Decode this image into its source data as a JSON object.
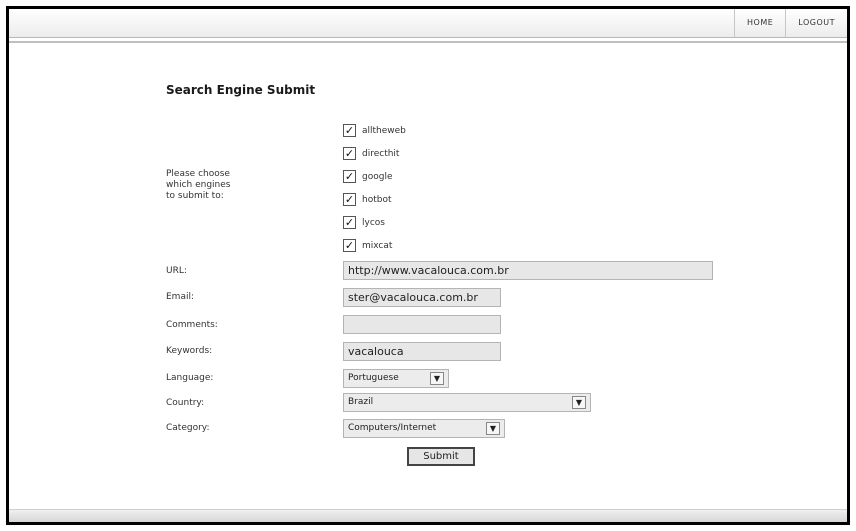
{
  "nav": {
    "home": "HOME",
    "logout": "LOGOUT"
  },
  "title": "Search Engine Submit",
  "engines": {
    "label_line1": "Please choose",
    "label_line2": "which engines",
    "label_line3": "to submit to:",
    "items": [
      {
        "name": "alltheweb",
        "checked": true
      },
      {
        "name": "directhit",
        "checked": true
      },
      {
        "name": "google",
        "checked": true
      },
      {
        "name": "hotbot",
        "checked": true
      },
      {
        "name": "lycos",
        "checked": true
      },
      {
        "name": "mixcat",
        "checked": true
      }
    ],
    "check_mark": "✓"
  },
  "url": {
    "label": "URL:",
    "value": "http://www.vacalouca.com.br"
  },
  "email": {
    "label": "Email:",
    "value": "ster@vacalouca.com.br"
  },
  "comments": {
    "label": "Comments:",
    "value": ""
  },
  "keywords": {
    "label": "Keywords:",
    "value": "vacalouca"
  },
  "language": {
    "label": "Language:",
    "value": "Portuguese"
  },
  "country": {
    "label": "Country:",
    "value": "Brazil"
  },
  "category": {
    "label": "Category:",
    "value": "Computers/Internet"
  },
  "submit": "Submit",
  "dropdown_arrow": "▼"
}
